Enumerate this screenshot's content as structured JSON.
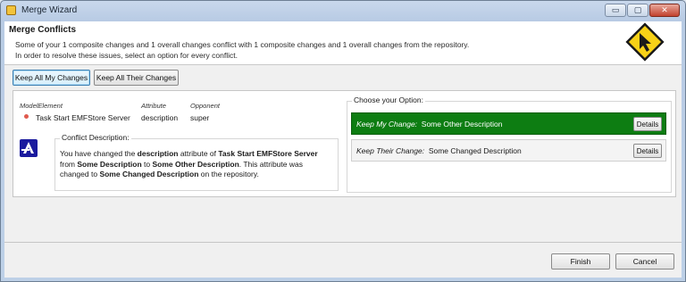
{
  "window": {
    "title": "Merge Wizard",
    "minimize_glyph": "▭",
    "maximize_glyph": "▢",
    "close_glyph": "✕"
  },
  "header": {
    "title": "Merge Conflicts",
    "line1": "Some of your 1 composite changes and 1 overall changes conflict with 1 composite changes and 1 overall changes from the repository.",
    "line2": "In order to resolve these issues, select an option for every conflict.",
    "icon": "wizard-cursor-sign-icon"
  },
  "actions": {
    "keep_mine_label": "Keep All My Changes",
    "keep_theirs_label": "Keep All Their Changes"
  },
  "conflict": {
    "columns": {
      "model_element": "ModelElement",
      "attribute": "Attribute",
      "opponent": "Opponent"
    },
    "row": {
      "model_element": "Task Start EMFStore Server",
      "attribute": "description",
      "opponent": "super"
    },
    "description_legend": "Conflict Description:",
    "description": {
      "p1": "You have changed the ",
      "b1": "description",
      "p2": " attribute of ",
      "b2": "Task Start EMFStore Server",
      "p3": " from ",
      "b3": "Some Description",
      "p4": " to ",
      "b4": "Some Other Description",
      "p5": ". This attribute was changed to ",
      "b5": "Some Changed Description",
      "p6": " on the repository."
    }
  },
  "options": {
    "legend": "Choose your Option:",
    "my_change": {
      "label": "Keep My Change:",
      "value": "Some Other Description",
      "details": "Details",
      "selected": true
    },
    "their_change": {
      "label": "Keep Their Change:",
      "value": "Some Changed Description",
      "details": "Details",
      "selected": false
    }
  },
  "footer": {
    "finish_label": "Finish",
    "cancel_label": "Cancel"
  },
  "colors": {
    "selected_option": "#0d7d12",
    "title_bar": "#c9d8ec",
    "close_button": "#c2412e"
  }
}
